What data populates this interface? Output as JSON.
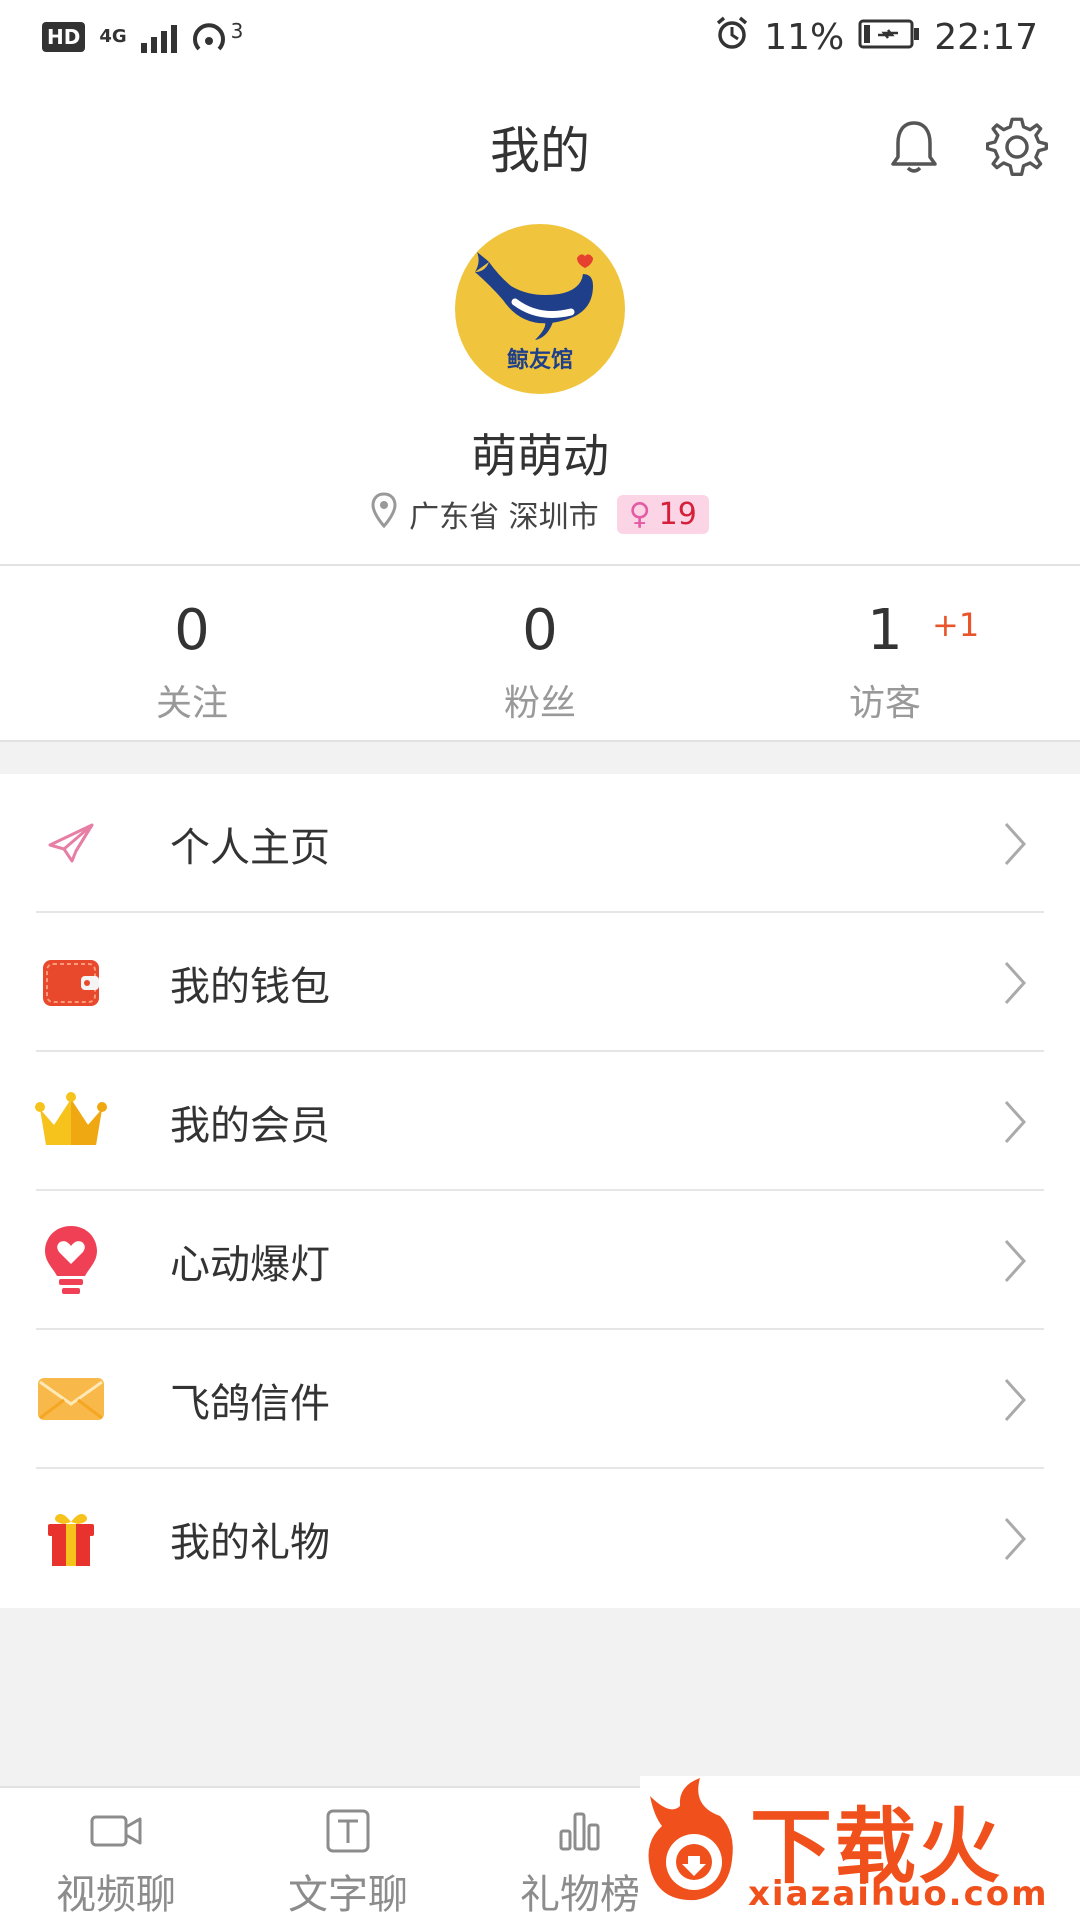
{
  "status_bar": {
    "hd": "HD",
    "network": "4G",
    "hotspot_count": "3",
    "battery": "11%",
    "time": "22:17"
  },
  "header": {
    "title": "我的",
    "icons": [
      "bell-icon",
      "gear-icon"
    ]
  },
  "profile": {
    "avatar_text": "鲸友馆",
    "name": "萌萌动",
    "location": "广东省 深圳市",
    "gender_symbol": "♀",
    "age": "19"
  },
  "stats": [
    {
      "value": "0",
      "label": "关注"
    },
    {
      "value": "0",
      "label": "粉丝"
    },
    {
      "value": "1",
      "label": "访客",
      "delta": "+1"
    }
  ],
  "menu": [
    {
      "label": "个人主页",
      "icon": "paper-plane-icon"
    },
    {
      "label": "我的钱包",
      "icon": "wallet-icon"
    },
    {
      "label": "我的会员",
      "icon": "crown-icon"
    },
    {
      "label": "心动爆灯",
      "icon": "heart-bulb-icon"
    },
    {
      "label": "飞鸽信件",
      "icon": "envelope-icon"
    },
    {
      "label": "我的礼物",
      "icon": "gift-icon"
    }
  ],
  "tabs": [
    {
      "label": "视频聊",
      "icon": "video-icon"
    },
    {
      "label": "文字聊",
      "icon": "text-icon"
    },
    {
      "label": "礼物榜",
      "icon": "bar-chart-icon"
    }
  ],
  "watermark": {
    "text": "下载火",
    "url": "xiazaihuo.com"
  },
  "colors": {
    "accent": "#e8552b",
    "gender_bg": "#fbd5e6",
    "gender_fg": "#d8337f",
    "avatar_bg": "#f0c53d"
  }
}
